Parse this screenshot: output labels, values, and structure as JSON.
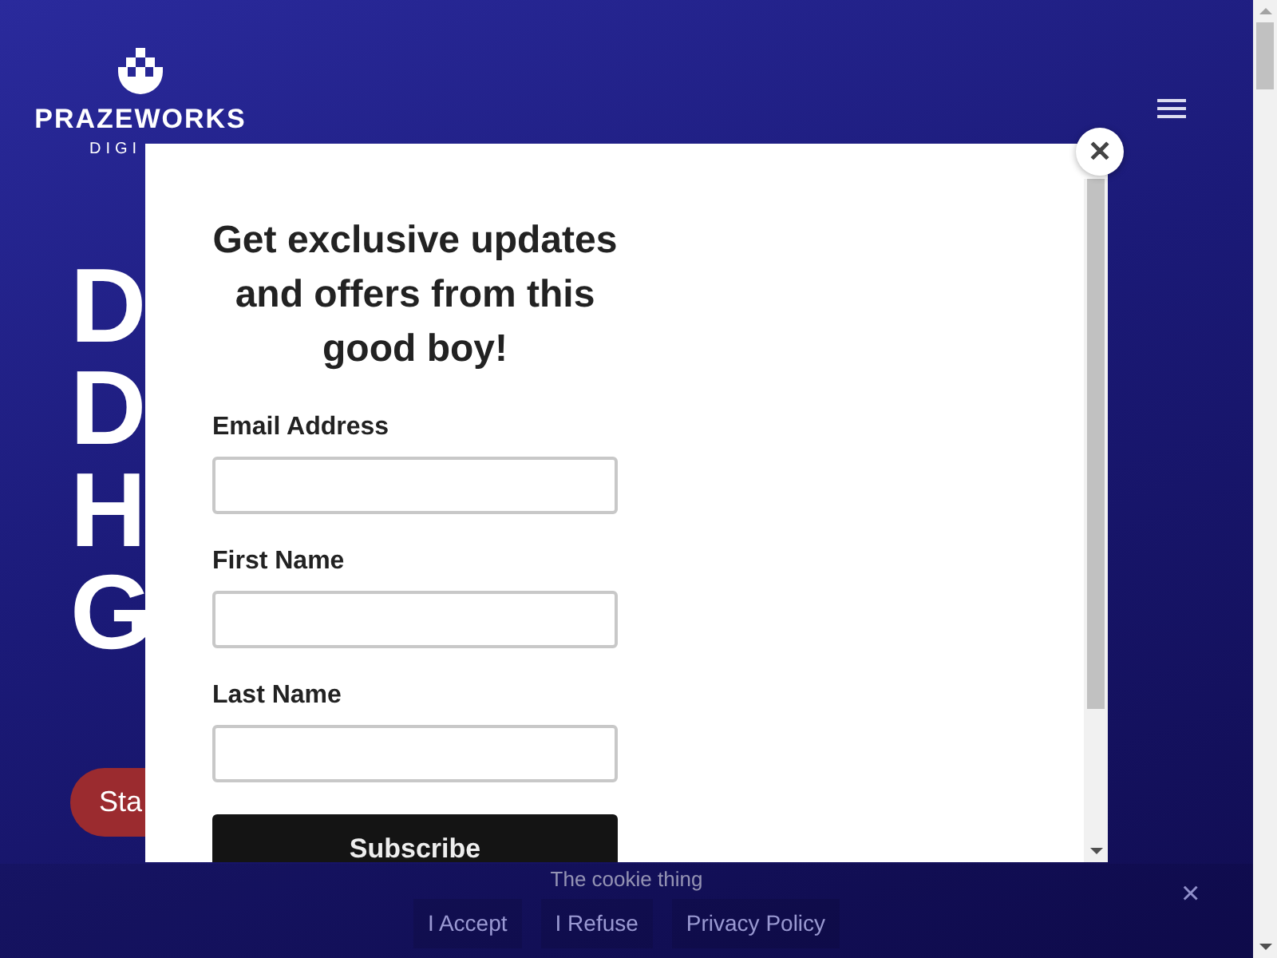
{
  "header": {
    "logo": {
      "name": "PRAZEWORKS",
      "tagline": "DIGI"
    }
  },
  "hero": {
    "heading_lines": [
      "D",
      "D",
      "H",
      "G"
    ],
    "button": "Sta"
  },
  "modal": {
    "title": "Get exclusive updates and offers from this good boy!",
    "fields": [
      {
        "label": "Email Address"
      },
      {
        "label": "First Name"
      },
      {
        "label": "Last Name"
      }
    ],
    "submit": "Subscribe",
    "close": "✕"
  },
  "cookie_bar": {
    "message": "The cookie thing",
    "buttons": [
      "I Accept",
      "I Refuse",
      "Privacy Policy"
    ],
    "close": "×"
  }
}
